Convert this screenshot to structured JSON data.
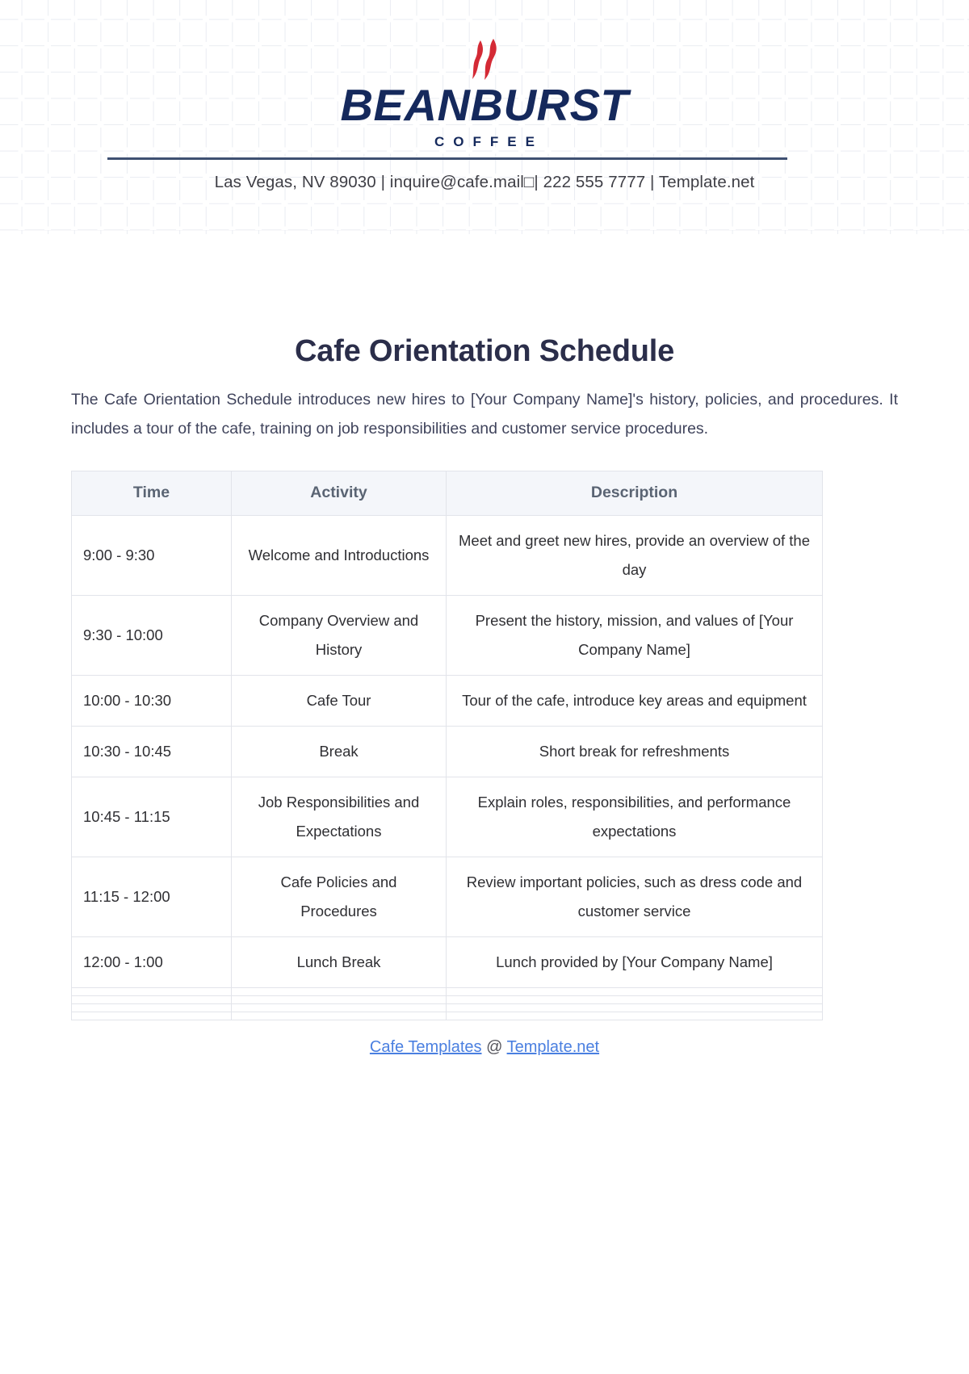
{
  "background": {
    "pattern": "rounded-square-grid",
    "grid_color": "#e9ecf2"
  },
  "letterhead": {
    "logo_icon": "flame-icon",
    "flame_color": "#d42a35",
    "brand_name": "BEANBURST",
    "brand_subtitle": "COFFEE",
    "brand_color": "#15295c",
    "divider_color": "#3f5172",
    "contact_line": "Las Vegas, NV 89030 | inquire@cafe.mail□| 222 555 7777 | Template.net"
  },
  "document": {
    "title": "Cafe Orientation Schedule",
    "intro": "The Cafe Orientation Schedule introduces new hires to [Your Company Name]'s history, policies, and procedures. It includes a tour of the cafe, training on job responsibilities and customer service procedures."
  },
  "table": {
    "headers": [
      "Time",
      "Activity",
      "Description"
    ],
    "rows": [
      {
        "time": "9:00 - 9:30",
        "activity": "Welcome and Introductions",
        "description": "Meet and greet new hires, provide an overview of the day"
      },
      {
        "time": "9:30 - 10:00",
        "activity": "Company Overview and History",
        "description": "Present the history, mission, and values of [Your Company Name]"
      },
      {
        "time": "10:00 - 10:30",
        "activity": "Cafe Tour",
        "description": "Tour of the cafe, introduce key areas and equipment"
      },
      {
        "time": "10:30 - 10:45",
        "activity": "Break",
        "description": "Short break for refreshments"
      },
      {
        "time": "10:45 - 11:15",
        "activity": "Job Responsibilities and Expectations",
        "description": "Explain roles, responsibilities, and performance expectations"
      },
      {
        "time": "11:15 - 12:00",
        "activity": "Cafe Policies and Procedures",
        "description": "Review important policies, such as dress code and customer service"
      },
      {
        "time": "12:00 - 1:00",
        "activity": "Lunch Break",
        "description": "Lunch provided by [Your Company Name]"
      }
    ],
    "blank_row_count": 4
  },
  "footer": {
    "link_primary": "Cafe Templates",
    "at_symbol": "@",
    "link_secondary": "Template.net",
    "link_color": "#4a7fe0"
  }
}
